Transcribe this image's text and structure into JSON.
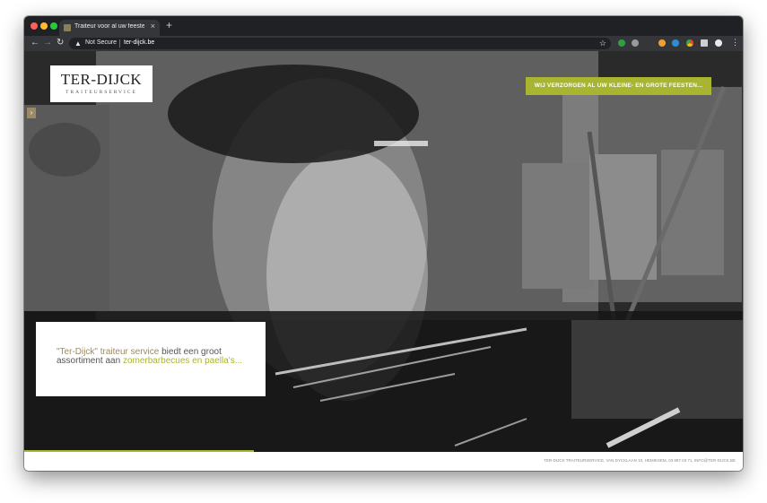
{
  "browser": {
    "tab_title": "Traiteur voor al uw feesten | Ter-Dijck",
    "tab_close": "×",
    "new_tab": "+",
    "security_label": "Not Secure",
    "url": "ter-dijck.be",
    "back_icon": "←",
    "forward_icon": "→",
    "reload_icon": "↻",
    "star_icon": "☆",
    "menu_icon": "⋮",
    "extensions": [
      "shield-extension",
      "gray-extension",
      "orange-extension",
      "blue-extension",
      "chrome-extension",
      "puzzle-icon",
      "profile-icon"
    ]
  },
  "site": {
    "logo_main": "TER-DIJCK",
    "logo_sub": "TRAITEURSERVICE",
    "banner": "WIJ VERZORGEN AL UW KLEINE- EN GROTE FEESTEN...",
    "side_arrow": "›",
    "caption": {
      "part1": "\"Ter-Dijck\" traiteur service",
      "part2": " biedt een groot assortiment aan ",
      "part3": "zomerbarbecues en paella's..."
    },
    "footer": "TER-DIJCK TRAITEURSERVICE, VAN DYCKLAAN 10, HEMIKSEM, 03 887 03 71, INFO@TER-DIJCK.BE",
    "colors": {
      "accent_green": "#a8b530",
      "accent_brown": "#9b8a63"
    },
    "slide_progress": 0.32
  }
}
